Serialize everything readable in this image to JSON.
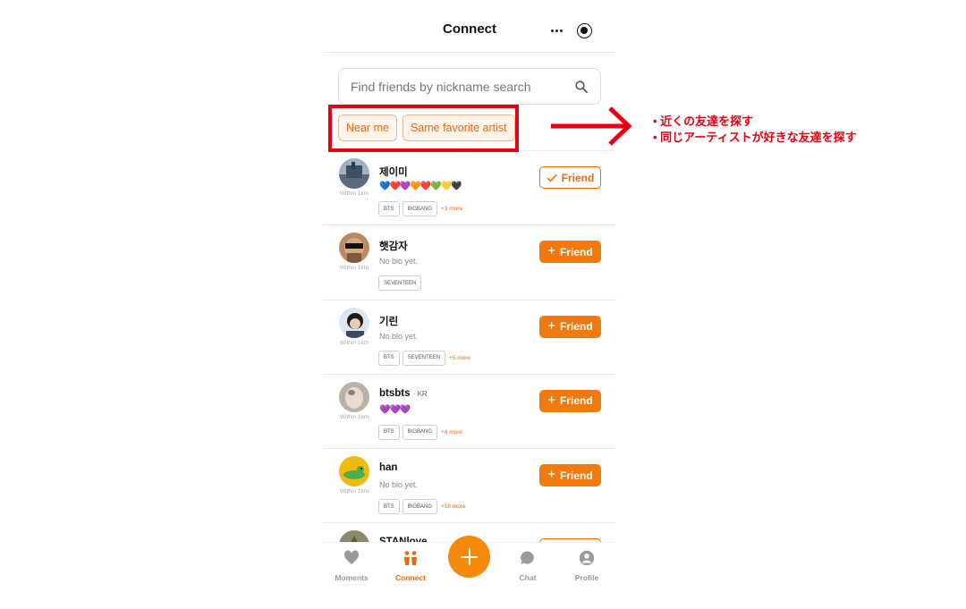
{
  "header": {
    "title": "Connect",
    "more_icon": "more-dots-icon",
    "target_icon": "record-target-icon"
  },
  "search": {
    "placeholder": "Find friends by nickname search",
    "value": ""
  },
  "filters": [
    {
      "label": "Near me"
    },
    {
      "label": "Same favorite artist"
    }
  ],
  "users": [
    {
      "name": "제이미",
      "country": "",
      "bio": "",
      "hearts": "💙❤️💜🧡❤️💚💛🖤",
      "distance": "Within 1km",
      "tags": [
        "BTS",
        "BIGBANG"
      ],
      "more": "+3 more",
      "button": "Friend",
      "is_friend": true
    },
    {
      "name": "햇감자",
      "country": "",
      "bio": "No bio yet.",
      "hearts": "",
      "distance": "Within 1km",
      "tags": [
        "SEVENTEEN"
      ],
      "more": "",
      "button": "Friend",
      "is_friend": false
    },
    {
      "name": "기린",
      "country": "",
      "bio": "No bio yet.",
      "hearts": "",
      "distance": "Within 1km",
      "tags": [
        "BTS",
        "SEVENTEEN"
      ],
      "more": "+5 more",
      "button": "Friend",
      "is_friend": false
    },
    {
      "name": "btsbts",
      "country": "· KR",
      "bio": "",
      "hearts": "💜💜💜",
      "distance": "Within 1km",
      "tags": [
        "BTS",
        "BIGBANG"
      ],
      "more": "+4 more",
      "button": "Friend",
      "is_friend": false
    },
    {
      "name": "han",
      "country": "",
      "bio": "No bio yet.",
      "hearts": "",
      "distance": "Within 1km",
      "tags": [
        "BTS",
        "BIGBANG"
      ],
      "more": "+18 more",
      "button": "Friend",
      "is_friend": false
    },
    {
      "name": "STANlove",
      "country": "",
      "bio": "",
      "hearts": "",
      "distance": "",
      "tags": [],
      "more": "",
      "button": "",
      "is_friend": false
    }
  ],
  "nav": [
    {
      "label": "Moments",
      "icon": "heart-chat-icon"
    },
    {
      "label": "Connect",
      "icon": "people-icon",
      "active": true
    },
    {
      "label": "",
      "icon": "plus-icon"
    },
    {
      "label": "Chat",
      "icon": "chat-bubble-icon"
    },
    {
      "label": "Profile",
      "icon": "person-icon"
    }
  ],
  "annotation": {
    "notes": [
      "近くの友達を探す",
      "同じアーティストが好きな友達を探す"
    ],
    "color": "#e60012"
  },
  "colors": {
    "accent": "#f07a0f",
    "chip_bg": "#fff4ec"
  }
}
